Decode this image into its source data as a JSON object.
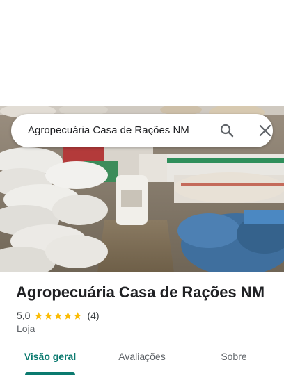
{
  "search": {
    "query": "Agropecuária Casa de Rações NM"
  },
  "place": {
    "name": "Agropecuária Casa de Rações NM",
    "rating": "5,0",
    "stars": 5,
    "review_count": "(4)",
    "category": "Loja"
  },
  "tabs": [
    {
      "label": "Visão geral",
      "active": true
    },
    {
      "label": "Avaliações",
      "active": false
    },
    {
      "label": "Sobre",
      "active": false
    }
  ],
  "colors": {
    "accent": "#0b7a6f",
    "star": "#fbbc04"
  }
}
